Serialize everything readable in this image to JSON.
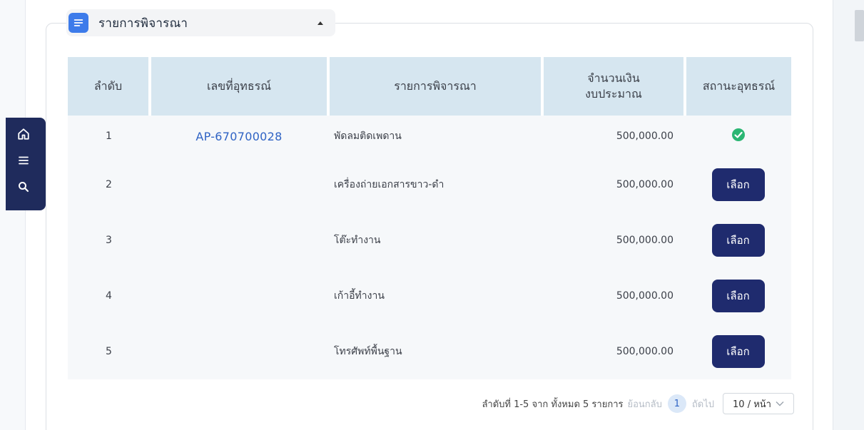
{
  "panel": {
    "title": "รายการพิจารณา"
  },
  "table": {
    "headers": {
      "num": "ลำดับ",
      "doc_no": "เลขที่อุทธรณ์",
      "item": "รายการพิจารณา",
      "amount_line1": "จำนวนเงิน",
      "amount_line2": "งบประมาณ",
      "status": "สถานะอุทธรณ์"
    },
    "rows": [
      {
        "num": "1",
        "doc_no": "AP-670700028",
        "item": "พัดลมติดเพดาน",
        "amount": "500,000.00",
        "status": "check"
      },
      {
        "num": "2",
        "doc_no": "",
        "item": "เครื่องถ่ายเอกสารขาว-ดำ",
        "amount": "500,000.00",
        "status": "เลือก"
      },
      {
        "num": "3",
        "doc_no": "",
        "item": "โต๊ะทำงาน",
        "amount": "500,000.00",
        "status": "เลือก"
      },
      {
        "num": "4",
        "doc_no": "",
        "item": "เก้าอี้ทำงาน",
        "amount": "500,000.00",
        "status": "เลือก"
      },
      {
        "num": "5",
        "doc_no": "",
        "item": "โทรศัพท์พื้นฐาน",
        "amount": "500,000.00",
        "status": "เลือก"
      }
    ]
  },
  "pagination": {
    "summary": "ลำดับที่ 1-5 จาก ทั้งหมด 5 รายการ",
    "prev": "ย้อนกลับ",
    "current": "1",
    "next": "ถัดไป",
    "page_size": "10 / หน้า"
  },
  "colors": {
    "accent": "#3d7bea",
    "button": "#1f2b6e",
    "header_bg": "#d6e6f0",
    "success": "#2bb673",
    "link": "#2f63c4"
  },
  "icons": [
    "home-icon",
    "menu-icon",
    "search-icon",
    "list-icon",
    "caret-up-icon",
    "check-circle-icon",
    "chevron-down-icon"
  ]
}
